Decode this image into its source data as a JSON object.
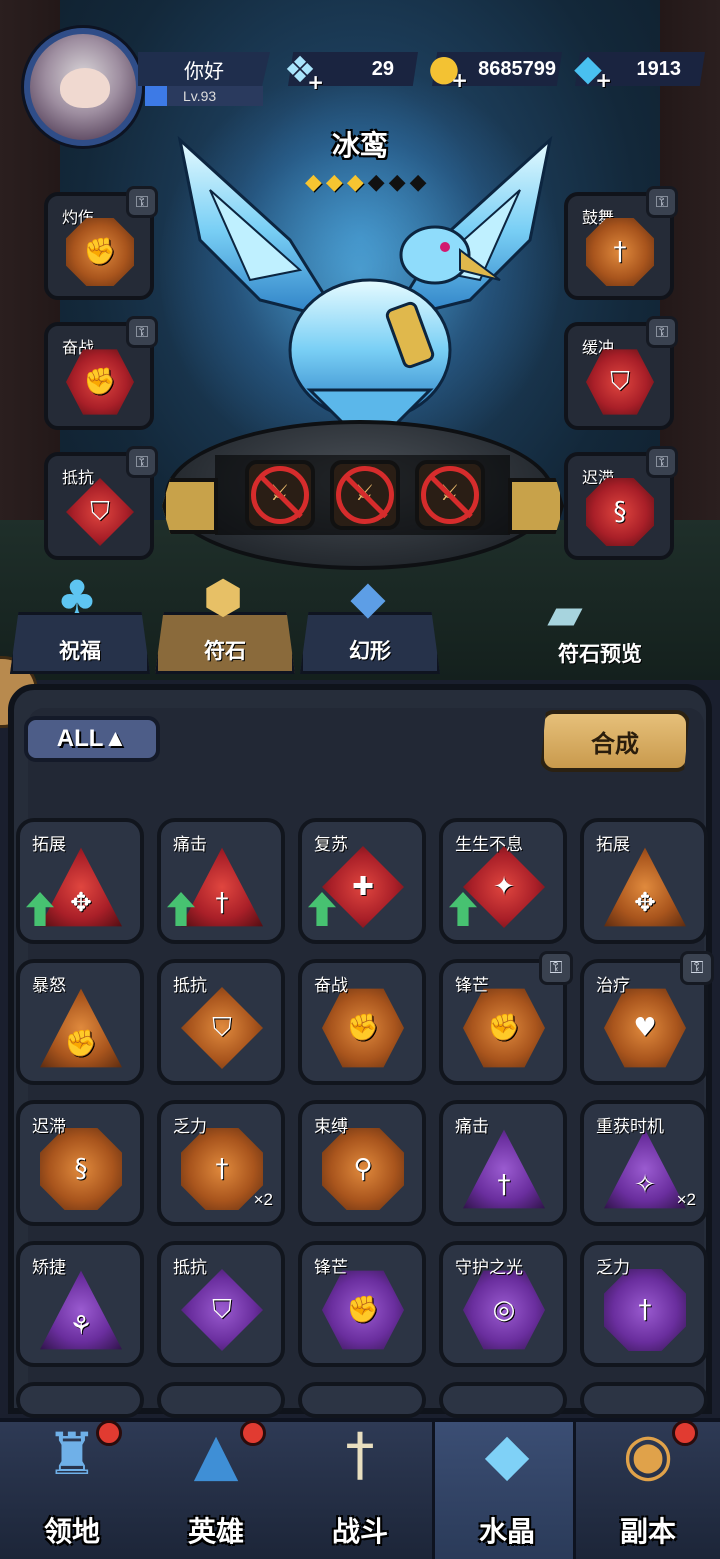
{
  "header": {
    "player_name": "你好",
    "level": "Lv.93",
    "resources": [
      {
        "icon": "crystal-shard-icon",
        "value": "29"
      },
      {
        "icon": "gold-coin-icon",
        "value": "8685799"
      },
      {
        "icon": "diamond-icon",
        "value": "1913"
      }
    ]
  },
  "hero": {
    "name": "冰鸾",
    "stars_filled": 3,
    "stars_total": 6
  },
  "side_slots": {
    "left": [
      {
        "label": "灼伤",
        "icon": "fist-rune-icon",
        "color": "orange",
        "shape": "oct"
      },
      {
        "label": "奋战",
        "icon": "fist-rune-icon",
        "color": "red",
        "shape": "hex"
      },
      {
        "label": "抵抗",
        "icon": "shield-rune-icon",
        "color": "red",
        "shape": "dia"
      }
    ],
    "right": [
      {
        "label": "鼓舞",
        "icon": "sword-rune-icon",
        "color": "orange",
        "shape": "oct"
      },
      {
        "label": "缓冲",
        "icon": "shield-rune-icon",
        "color": "red",
        "shape": "hex"
      },
      {
        "label": "迟滞",
        "icon": "snail-rune-icon",
        "color": "red",
        "shape": "oct"
      }
    ]
  },
  "tabs": [
    {
      "label": "祝福",
      "icon": "clover-icon"
    },
    {
      "label": "符石",
      "icon": "rune-stone-icon"
    },
    {
      "label": "幻形",
      "icon": "crystal-icon"
    },
    {
      "label": "符石预览",
      "icon": "book-icon"
    }
  ],
  "filter": {
    "label": "ALL▲"
  },
  "compose_button": "合成",
  "runes": [
    {
      "label": "拓展",
      "shape": "tri",
      "color": "red",
      "upgrade": true
    },
    {
      "label": "痛击",
      "shape": "tri",
      "color": "red",
      "upgrade": true
    },
    {
      "label": "复苏",
      "shape": "dia",
      "color": "red",
      "upgrade": true
    },
    {
      "label": "生生不息",
      "shape": "dia",
      "color": "red",
      "upgrade": true
    },
    {
      "label": "拓展",
      "shape": "tri",
      "color": "orange",
      "upgrade": false
    },
    {
      "label": "暴怒",
      "shape": "tri",
      "color": "orange",
      "upgrade": false
    },
    {
      "label": "抵抗",
      "shape": "dia",
      "color": "orange",
      "upgrade": false
    },
    {
      "label": "奋战",
      "shape": "hex",
      "color": "orange",
      "upgrade": false
    },
    {
      "label": "锋芒",
      "shape": "hex",
      "color": "orange",
      "upgrade": false,
      "locked": true
    },
    {
      "label": "治疗",
      "shape": "hex",
      "color": "orange",
      "upgrade": false,
      "locked": true
    },
    {
      "label": "迟滞",
      "shape": "oct",
      "color": "orange",
      "upgrade": false
    },
    {
      "label": "乏力",
      "shape": "oct",
      "color": "orange",
      "upgrade": false,
      "qty": "×2"
    },
    {
      "label": "束缚",
      "shape": "oct",
      "color": "orange",
      "upgrade": false
    },
    {
      "label": "痛击",
      "shape": "tri",
      "color": "purple",
      "upgrade": false
    },
    {
      "label": "重获时机",
      "shape": "tri",
      "color": "purple",
      "upgrade": false,
      "qty": "×2"
    },
    {
      "label": "矫捷",
      "shape": "tri",
      "color": "purple",
      "upgrade": false
    },
    {
      "label": "抵抗",
      "shape": "dia",
      "color": "purple",
      "upgrade": false
    },
    {
      "label": "锋芒",
      "shape": "hex",
      "color": "purple",
      "upgrade": false
    },
    {
      "label": "守护之光",
      "shape": "hex",
      "color": "purple",
      "upgrade": false
    },
    {
      "label": "乏力",
      "shape": "oct",
      "color": "purple",
      "upgrade": false
    }
  ],
  "nav": [
    {
      "label": "领地",
      "icon": "castle-icon",
      "badge": true
    },
    {
      "label": "英雄",
      "icon": "wizard-hat-icon",
      "badge": true
    },
    {
      "label": "战斗",
      "icon": "sword-icon",
      "badge": false
    },
    {
      "label": "水晶",
      "icon": "crystal-orb-icon",
      "badge": false,
      "active": true
    },
    {
      "label": "副本",
      "icon": "portal-icon",
      "badge": true
    }
  ],
  "colors": {
    "accent_gold": "#c99a4d",
    "rarity_red": "#a91f28",
    "rarity_orange": "#a9551d",
    "rarity_purple": "#6a2e9e",
    "upgrade_green": "#47c271"
  }
}
